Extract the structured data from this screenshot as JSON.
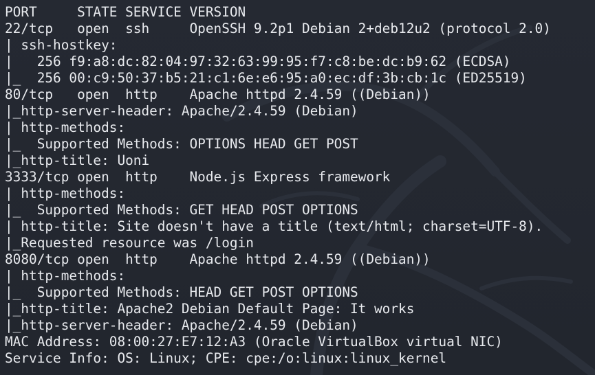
{
  "terminal": {
    "lines": [
      "PORT     STATE SERVICE VERSION",
      "22/tcp   open  ssh     OpenSSH 9.2p1 Debian 2+deb12u2 (protocol 2.0)",
      "| ssh-hostkey:",
      "|   256 f9:a8:dc:82:04:97:32:63:99:95:f7:c8:be:dc:b9:62 (ECDSA)",
      "|_  256 00:c9:50:37:b5:21:c1:6e:e6:95:a0:ec:df:3b:cb:1c (ED25519)",
      "80/tcp   open  http    Apache httpd 2.4.59 ((Debian))",
      "|_http-server-header: Apache/2.4.59 (Debian)",
      "| http-methods:",
      "|_  Supported Methods: OPTIONS HEAD GET POST",
      "|_http-title: Uoni",
      "3333/tcp open  http    Node.js Express framework",
      "| http-methods:",
      "|_  Supported Methods: GET HEAD POST OPTIONS",
      "| http-title: Site doesn't have a title (text/html; charset=UTF-8).",
      "|_Requested resource was /login",
      "8080/tcp open  http    Apache httpd 2.4.59 ((Debian))",
      "| http-methods:",
      "|_  Supported Methods: HEAD GET POST OPTIONS",
      "|_http-title: Apache2 Debian Default Page: It works",
      "|_http-server-header: Apache/2.4.59 (Debian)",
      "MAC Address: 08:00:27:E7:12:A3 (Oracle VirtualBox virtual NIC)",
      "Service Info: OS: Linux; CPE: cpe:/o:linux:linux_kernel"
    ]
  },
  "icons": {
    "background_logo": "kali-dragon-icon"
  },
  "colors": {
    "background": "#232730",
    "text": "#e8eaee",
    "watermark": "#2c313b"
  }
}
